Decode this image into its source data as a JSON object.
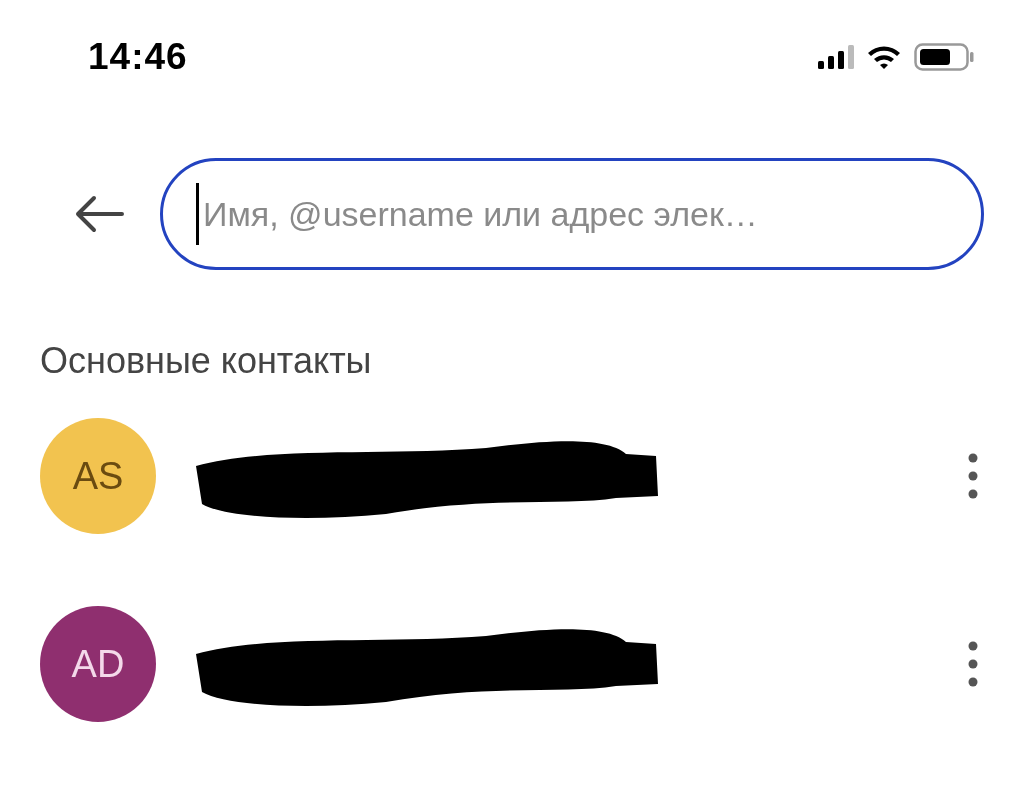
{
  "status_bar": {
    "time": "14:46"
  },
  "search": {
    "placeholder": "Имя, @username или адрес элек…",
    "focused": true
  },
  "section": {
    "title": "Основные контакты"
  },
  "contacts": [
    {
      "initials": "AS",
      "color": "#f2c34f",
      "name_redacted": true
    },
    {
      "initials": "AD",
      "color": "#8f2f6f",
      "name_redacted": true
    }
  ]
}
